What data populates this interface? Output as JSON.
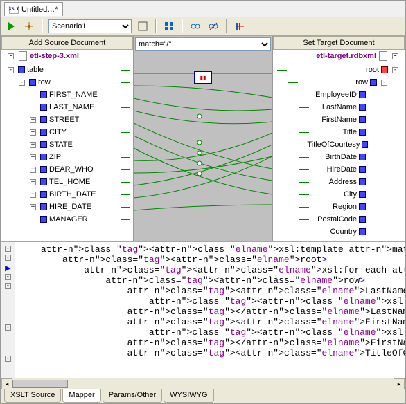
{
  "document": {
    "title": "Untitled…*"
  },
  "toolbar": {
    "scenario": "Scenario1"
  },
  "mapper": {
    "source": {
      "header": "Add Source Document",
      "filename": "etl-step-3.xml",
      "nodes": [
        {
          "label": "table",
          "indent": 0,
          "exp": "-",
          "icon": "elem"
        },
        {
          "label": "row",
          "indent": 1,
          "exp": "-",
          "icon": "elem"
        },
        {
          "label": "FIRST_NAME",
          "indent": 2,
          "exp": "",
          "icon": "elem"
        },
        {
          "label": "LAST_NAME",
          "indent": 2,
          "exp": "",
          "icon": "elem"
        },
        {
          "label": "STREET",
          "indent": 2,
          "exp": "+",
          "icon": "elem"
        },
        {
          "label": "CITY",
          "indent": 2,
          "exp": "+",
          "icon": "elem"
        },
        {
          "label": "STATE",
          "indent": 2,
          "exp": "+",
          "icon": "elem"
        },
        {
          "label": "ZIP",
          "indent": 2,
          "exp": "+",
          "icon": "elem"
        },
        {
          "label": "DEAR_WHO",
          "indent": 2,
          "exp": "+",
          "icon": "elem"
        },
        {
          "label": "TEL_HOME",
          "indent": 2,
          "exp": "+",
          "icon": "elem"
        },
        {
          "label": "BIRTH_DATE",
          "indent": 2,
          "exp": "+",
          "icon": "elem"
        },
        {
          "label": "HIRE_DATE",
          "indent": 2,
          "exp": "+",
          "icon": "elem"
        },
        {
          "label": "MANAGER",
          "indent": 2,
          "exp": "",
          "icon": "elem"
        }
      ]
    },
    "match": "match=\"/\"",
    "target": {
      "header": "Set Target Document",
      "filename": "etl-target.rdbxml",
      "nodes": [
        {
          "label": "root",
          "indent": 0,
          "exp": "-",
          "icon": "root"
        },
        {
          "label": "row",
          "indent": 1,
          "exp": "-",
          "icon": "elem"
        },
        {
          "label": "EmployeeID",
          "indent": 2,
          "exp": "",
          "icon": "elem"
        },
        {
          "label": "LastName",
          "indent": 2,
          "exp": "",
          "icon": "elem"
        },
        {
          "label": "FirstName",
          "indent": 2,
          "exp": "",
          "icon": "elem"
        },
        {
          "label": "Title",
          "indent": 2,
          "exp": "",
          "icon": "elem"
        },
        {
          "label": "TitleOfCourtesy",
          "indent": 2,
          "exp": "",
          "icon": "elem"
        },
        {
          "label": "BirthDate",
          "indent": 2,
          "exp": "",
          "icon": "elem"
        },
        {
          "label": "HireDate",
          "indent": 2,
          "exp": "",
          "icon": "elem"
        },
        {
          "label": "Address",
          "indent": 2,
          "exp": "",
          "icon": "elem"
        },
        {
          "label": "City",
          "indent": 2,
          "exp": "",
          "icon": "elem"
        },
        {
          "label": "Region",
          "indent": 2,
          "exp": "",
          "icon": "elem"
        },
        {
          "label": "PostalCode",
          "indent": 2,
          "exp": "",
          "icon": "elem"
        },
        {
          "label": "Country",
          "indent": 2,
          "exp": "",
          "icon": "elem"
        }
      ]
    }
  },
  "code": {
    "lines": [
      "    <xsl:template match=\"/\">",
      "        <root>",
      "            <xsl:for-each select=\"table/row\">",
      "                <row>",
      "                    <LastName>",
      "                        <xsl:value-of select=\"LAST_NAME\"/>",
      "                    </LastName>",
      "                    <FirstName>",
      "                        <xsl:value-of select=\"FIRST_NAME\"/>",
      "                    </FirstName>",
      "                    <TitleOfCourtesy>"
    ]
  },
  "tabs": [
    {
      "label": "XSLT Source",
      "active": false
    },
    {
      "label": "Mapper",
      "active": true
    },
    {
      "label": "Params/Other",
      "active": false
    },
    {
      "label": "WYSIWYG",
      "active": false
    }
  ]
}
